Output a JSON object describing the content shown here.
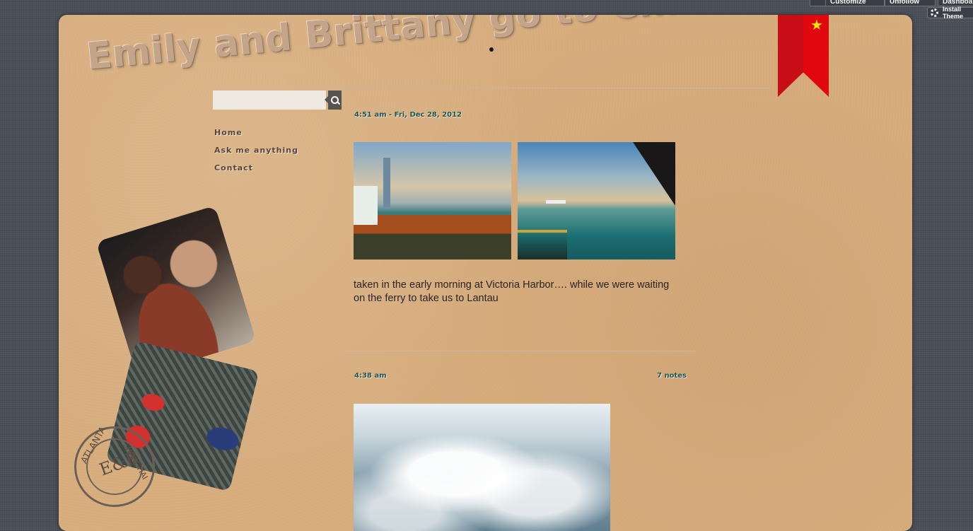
{
  "toolbar": {
    "customize_label": "Customize",
    "unfollow_label": "Unfollow",
    "dashboard_label": "Dashboard",
    "install_label": "Install Theme"
  },
  "blog": {
    "title": "Emily and Brittany go to China"
  },
  "search": {
    "placeholder": ""
  },
  "nav": {
    "items": [
      {
        "label": "Home"
      },
      {
        "label": "Ask me anything"
      },
      {
        "label": "Contact"
      }
    ]
  },
  "stamp": {
    "top_text": "ATLANTA",
    "side_text": "SHANGHAI",
    "monogram": "E&B"
  },
  "posts": [
    {
      "timestamp": "4:51 am - Fri, Dec 28, 2012",
      "notes": "",
      "caption": "taken in the early morning at Victoria Harbor…. while we were waiting on the ferry to take us to Lantau"
    },
    {
      "timestamp": "4:38 am",
      "notes": "7 notes",
      "caption": ""
    }
  ],
  "colors": {
    "paper": "#d8ae7f",
    "ribbon": "#e0080e",
    "star": "#ffe800",
    "meta_text": "#1e5a5a"
  }
}
